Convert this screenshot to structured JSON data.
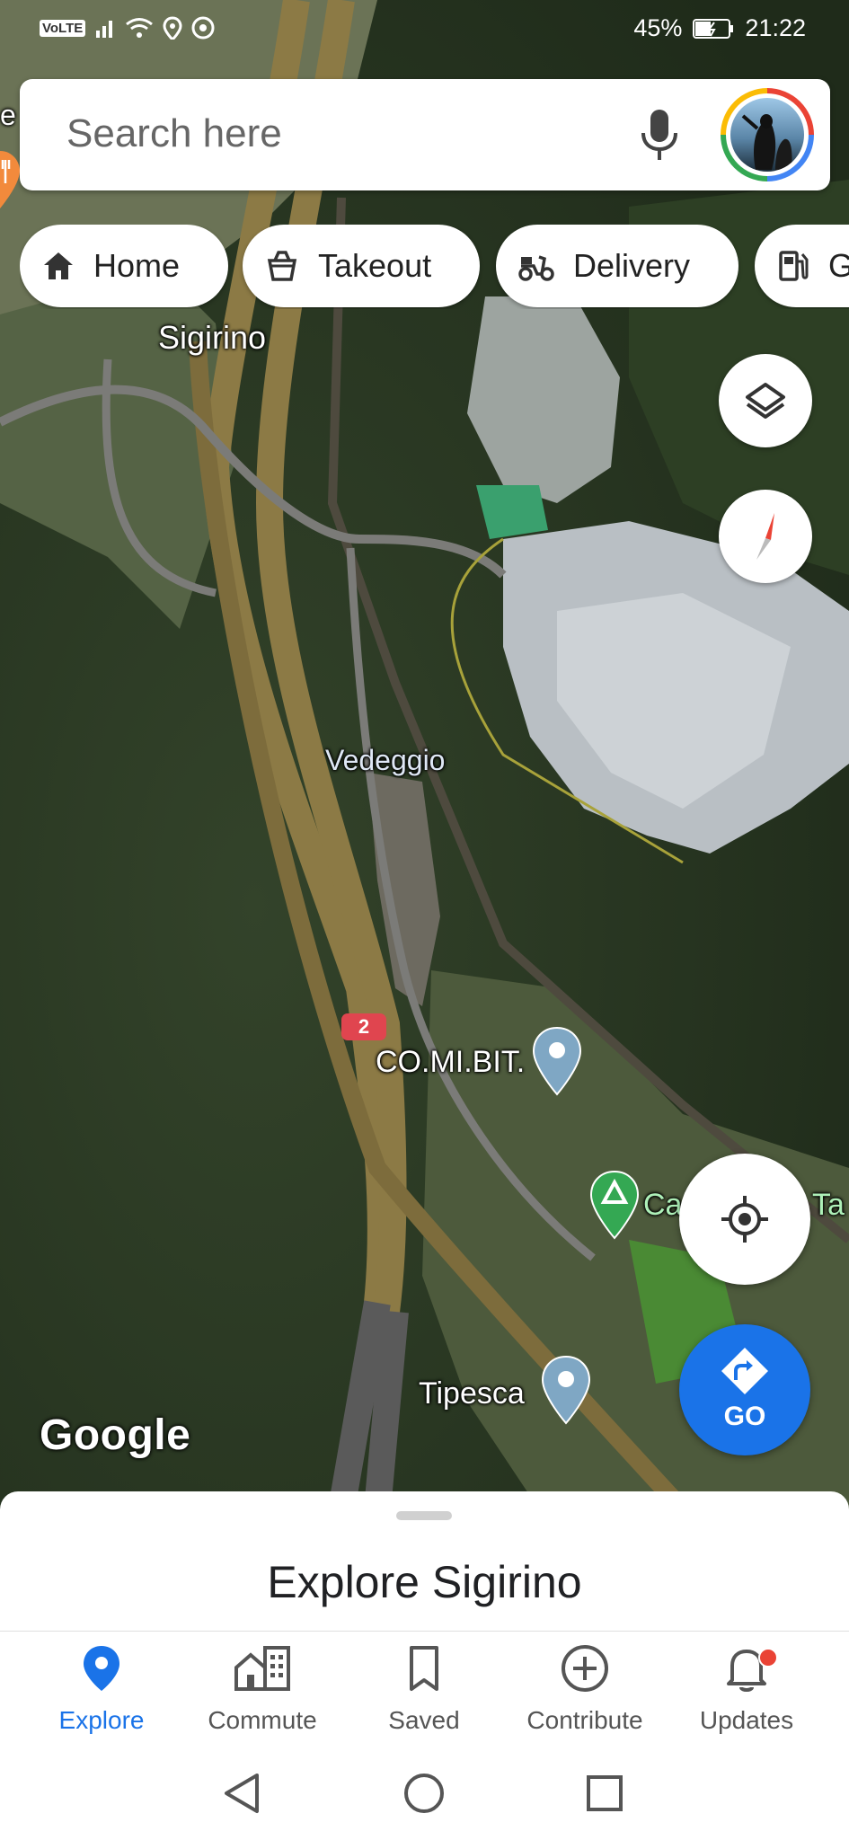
{
  "status_bar": {
    "network_badge": "VoLTE",
    "battery": "45%",
    "time": "21:22"
  },
  "search": {
    "placeholder": "Search here"
  },
  "chips": [
    {
      "label": "Home",
      "icon": "home-icon"
    },
    {
      "label": "Takeout",
      "icon": "takeout-icon"
    },
    {
      "label": "Delivery",
      "icon": "delivery-icon"
    },
    {
      "label": "G",
      "icon": "gas-station-icon"
    }
  ],
  "map": {
    "labels": {
      "town": "Sigirino",
      "river": "Vedeggio",
      "business": "CO.MI.BIT.",
      "camping": "Ca",
      "camping_suffix": "Ta",
      "place": "Tipesca",
      "road_shield": "2"
    },
    "logo": "Google"
  },
  "controls": {
    "go_label": "GO"
  },
  "sheet": {
    "title": "Explore Sigirino"
  },
  "bottom_nav": [
    {
      "label": "Explore",
      "icon": "explore-pin-icon",
      "active": true
    },
    {
      "label": "Commute",
      "icon": "commute-icon",
      "active": false
    },
    {
      "label": "Saved",
      "icon": "bookmark-icon",
      "active": false
    },
    {
      "label": "Contribute",
      "icon": "add-circle-icon",
      "active": false
    },
    {
      "label": "Updates",
      "icon": "bell-icon",
      "active": false,
      "badge": true
    }
  ],
  "colors": {
    "accent": "#1a73e8",
    "badge": "#ea4335"
  }
}
